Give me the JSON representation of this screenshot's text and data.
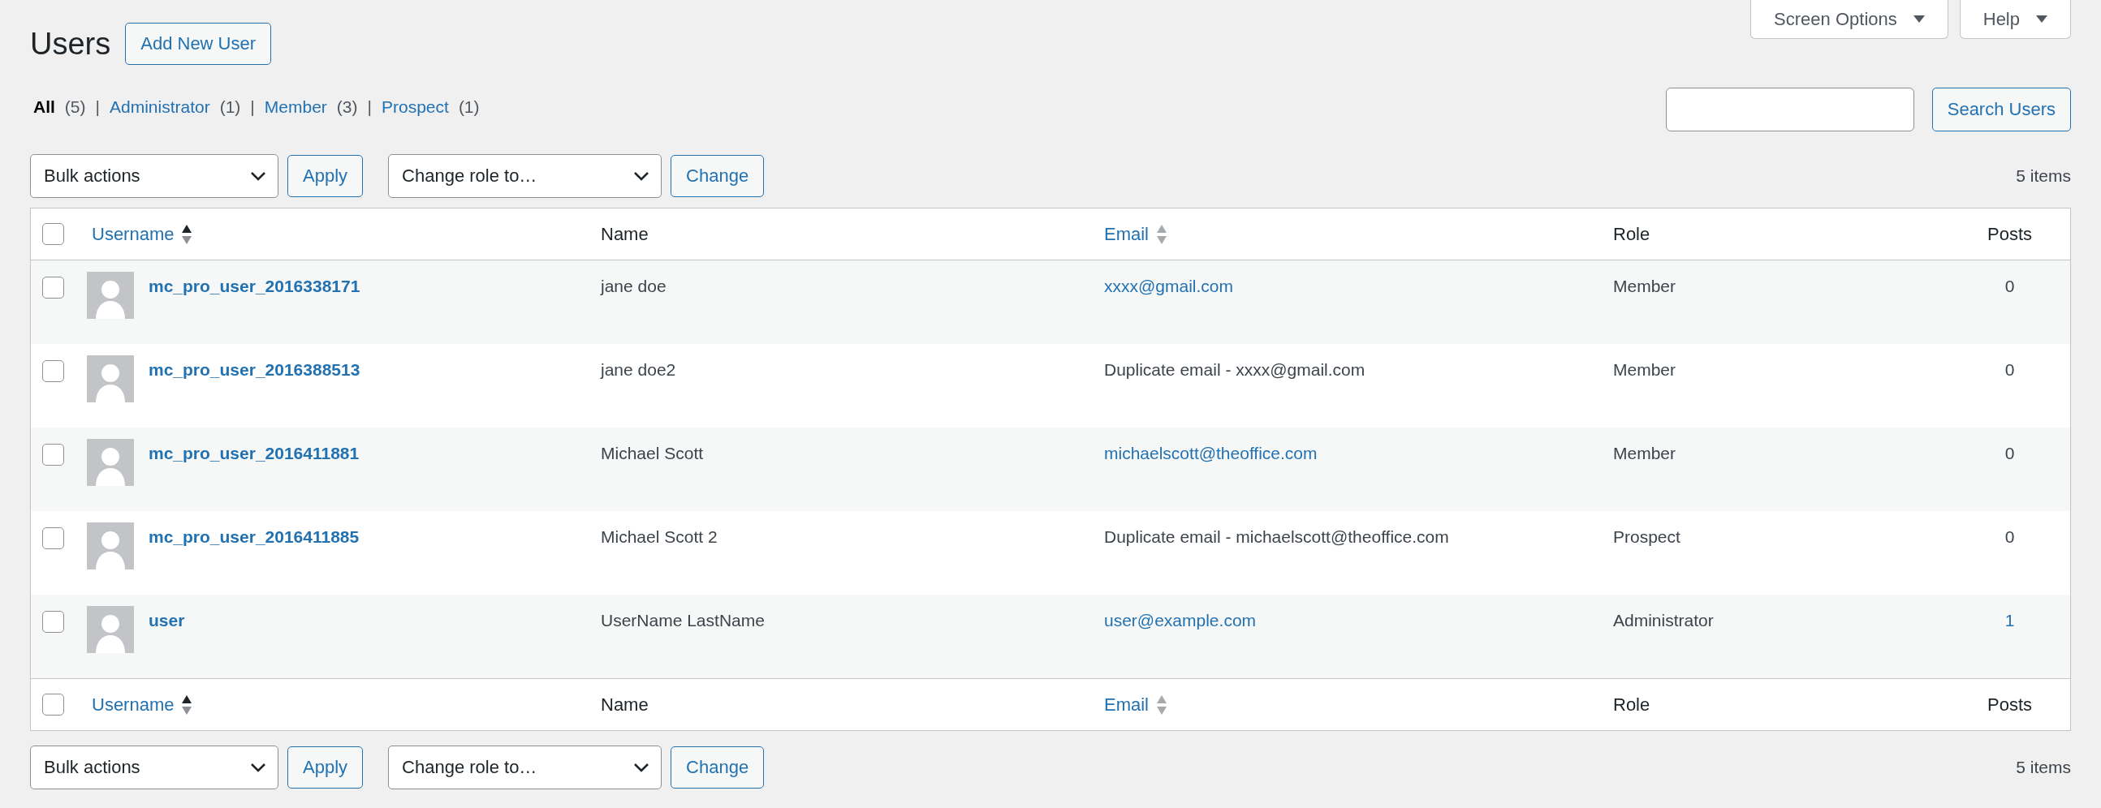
{
  "header": {
    "title": "Users",
    "add_button": "Add New User",
    "screen_options": "Screen Options",
    "help": "Help"
  },
  "filters": [
    {
      "label": "All",
      "count": "(5)",
      "selected": true,
      "separator": "|"
    },
    {
      "label": "Administrator",
      "count": "(1)",
      "selected": false,
      "separator": "|"
    },
    {
      "label": "Member",
      "count": "(3)",
      "selected": false,
      "separator": "|"
    },
    {
      "label": "Prospect",
      "count": "(1)",
      "selected": false
    }
  ],
  "search": {
    "button": "Search Users"
  },
  "tablenav_top": {
    "bulk": "Bulk actions",
    "apply": "Apply",
    "role": "Change role to…",
    "change": "Change",
    "count": "5 items"
  },
  "table": {
    "select_all_checked": false,
    "columns": [
      {
        "label": "Username",
        "sortable": true,
        "sorted": true
      },
      {
        "label": "Name",
        "sortable": false
      },
      {
        "label": "Email",
        "sortable": true,
        "sorted": false
      },
      {
        "label": "Role",
        "sortable": false
      },
      {
        "label": "Posts",
        "sortable": false
      }
    ],
    "rows": [
      {
        "checked": false,
        "username": "mc_pro_user_2016338171",
        "name": "jane doe",
        "email": "xxxx@gmail.com",
        "email_link": true,
        "role": "Member",
        "posts": "0",
        "posts_link": false
      },
      {
        "checked": false,
        "username": "mc_pro_user_2016388513",
        "name": "jane doe2",
        "email": "Duplicate email - xxxx@gmail.com",
        "email_link": false,
        "role": "Member",
        "posts": "0",
        "posts_link": false
      },
      {
        "checked": false,
        "username": "mc_pro_user_2016411881",
        "name": "Michael Scott",
        "email": "michaelscott@theoffice.com",
        "email_link": true,
        "role": "Member",
        "posts": "0",
        "posts_link": false
      },
      {
        "checked": false,
        "username": "mc_pro_user_2016411885",
        "name": "Michael Scott 2",
        "email": "Duplicate email - michaelscott@theoffice.com",
        "email_link": false,
        "role": "Prospect",
        "posts": "0",
        "posts_link": false
      },
      {
        "checked": false,
        "username": "user",
        "name": "UserName LastName",
        "email": "user@example.com",
        "email_link": true,
        "role": "Administrator",
        "posts": "1",
        "posts_link": true
      }
    ],
    "footer_checked": false,
    "footer_columns": [
      {
        "label": "Username",
        "sortable": true,
        "sorted": true
      },
      {
        "label": "Name",
        "sortable": false
      },
      {
        "label": "Email",
        "sortable": true,
        "sorted": false
      },
      {
        "label": "Role",
        "sortable": false
      },
      {
        "label": "Posts",
        "sortable": false
      }
    ]
  },
  "tablenav_bottom": {
    "bulk": "Bulk actions",
    "apply": "Apply",
    "role": "Change role to…",
    "change": "Change",
    "count": "5 items"
  }
}
